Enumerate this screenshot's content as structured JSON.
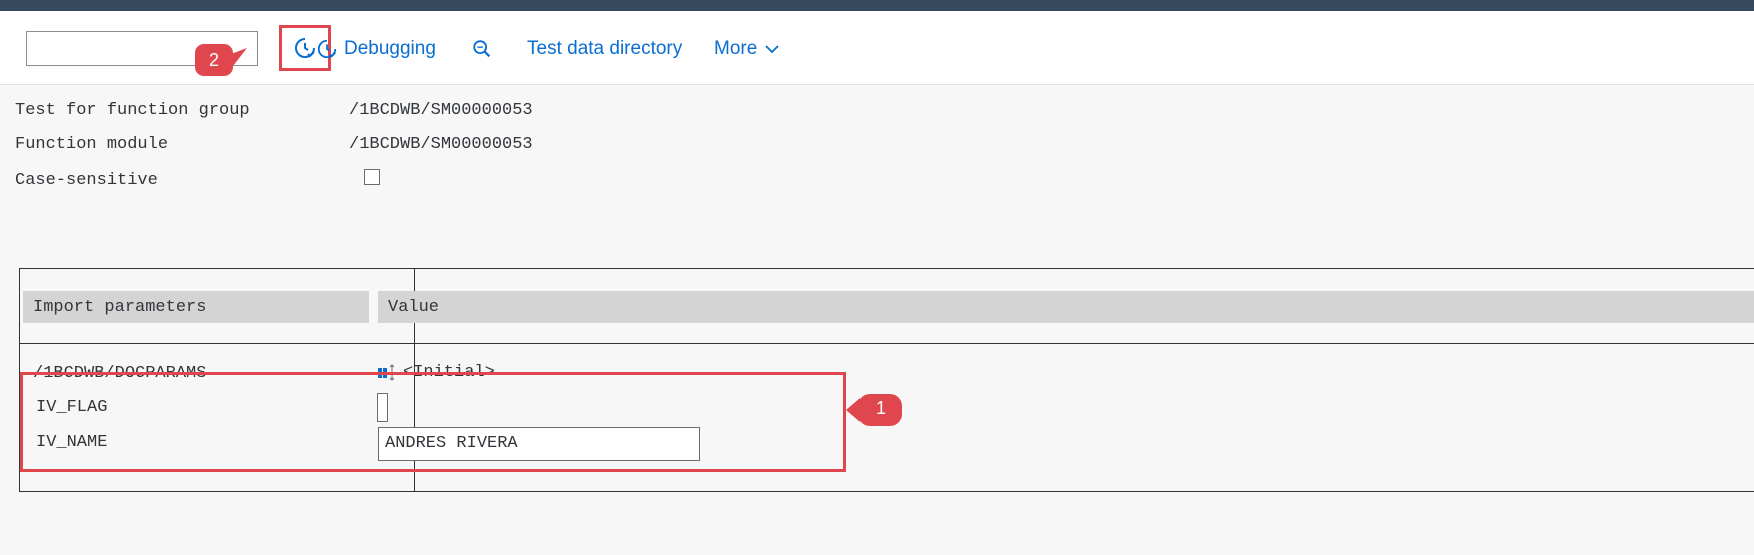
{
  "toolbar": {
    "command_field_value": "",
    "execute_icon": "clock-check-icon",
    "debugging_label": "Debugging",
    "debugging_icon": "clock-check-icon",
    "search_icon": "zoom-icon",
    "test_data_directory_label": "Test data directory",
    "more_label": "More",
    "more_icon": "chevron-down-icon"
  },
  "form": {
    "function_group_label": "Test for function group",
    "function_group_value": "/1BCDWB/SM00000053",
    "function_module_label": "Function module",
    "function_module_value": "/1BCDWB/SM00000053",
    "case_sensitive_label": "Case-sensitive",
    "case_sensitive_checked": false
  },
  "params": {
    "header_name": "Import parameters",
    "header_value": "Value",
    "rows": [
      {
        "name": "/1BCDWB/DOCPARAMS",
        "value": "<Initial>",
        "icon": "structure-icon"
      },
      {
        "name": "IV_FLAG",
        "value": ""
      },
      {
        "name": "IV_NAME",
        "value": "ANDRES RIVERA"
      }
    ]
  },
  "callouts": {
    "badge_1": "1",
    "badge_2": "2"
  },
  "colors": {
    "shell_bar": "#354a5f",
    "link": "#0a6ed1",
    "highlight": "#e0464d"
  }
}
